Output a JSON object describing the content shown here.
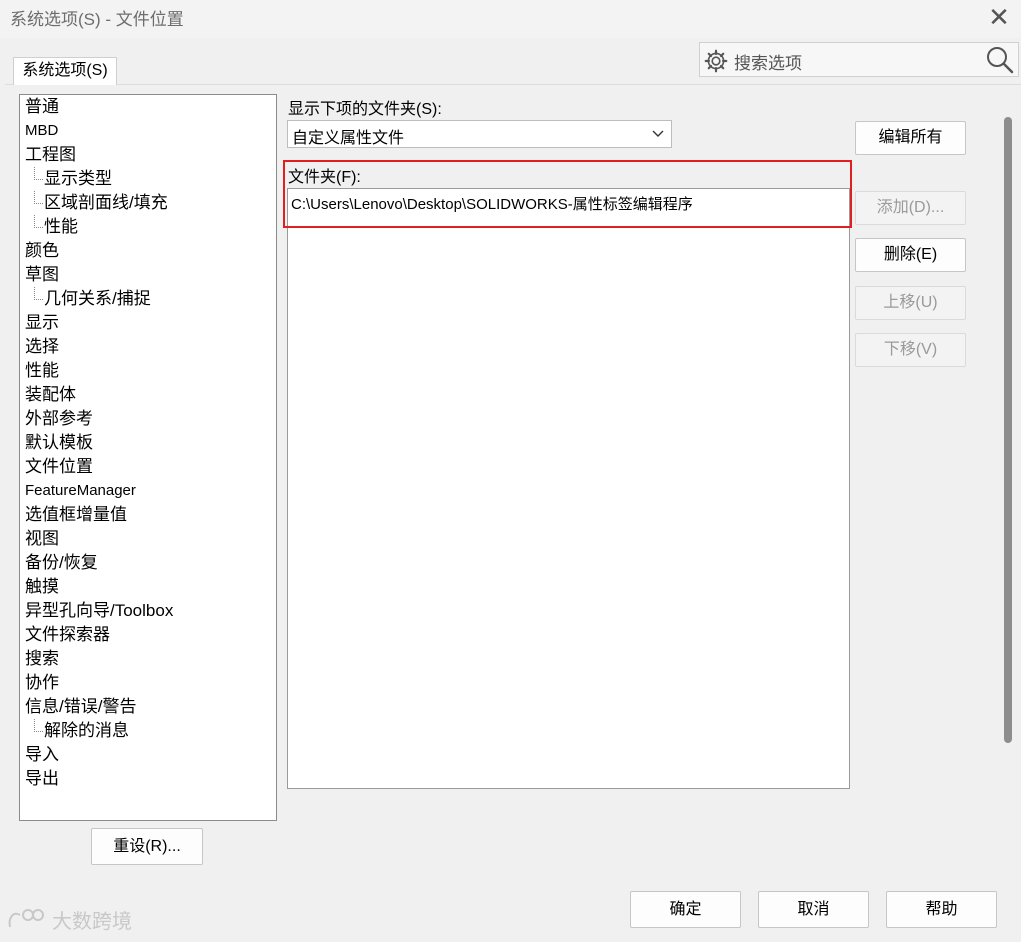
{
  "window": {
    "title": "系统选项(S) - 文件位置"
  },
  "search": {
    "placeholder": "搜索选项"
  },
  "tab": {
    "label": "系统选项(S)"
  },
  "tree": {
    "items": [
      {
        "label": "普通",
        "level": 0
      },
      {
        "label": "MBD",
        "level": 0
      },
      {
        "label": "工程图",
        "level": 0
      },
      {
        "label": "显示类型",
        "level": 1
      },
      {
        "label": "区域剖面线/填充",
        "level": 1
      },
      {
        "label": "性能",
        "level": 1
      },
      {
        "label": "颜色",
        "level": 0
      },
      {
        "label": "草图",
        "level": 0
      },
      {
        "label": "几何关系/捕捉",
        "level": 1
      },
      {
        "label": "显示",
        "level": 0
      },
      {
        "label": "选择",
        "level": 0
      },
      {
        "label": "性能",
        "level": 0
      },
      {
        "label": "装配体",
        "level": 0
      },
      {
        "label": "外部参考",
        "level": 0
      },
      {
        "label": "默认模板",
        "level": 0
      },
      {
        "label": "文件位置",
        "level": 0
      },
      {
        "label": "FeatureManager",
        "level": 0
      },
      {
        "label": "选值框增量值",
        "level": 0
      },
      {
        "label": "视图",
        "level": 0
      },
      {
        "label": "备份/恢复",
        "level": 0
      },
      {
        "label": "触摸",
        "level": 0
      },
      {
        "label": "异型孔向导/Toolbox",
        "level": 0
      },
      {
        "label": "文件探索器",
        "level": 0
      },
      {
        "label": "搜索",
        "level": 0
      },
      {
        "label": "协作",
        "level": 0
      },
      {
        "label": "信息/错误/警告",
        "level": 0
      },
      {
        "label": "解除的消息",
        "level": 1
      },
      {
        "label": "导入",
        "level": 0
      },
      {
        "label": "导出",
        "level": 0
      }
    ],
    "reset_label": "重设(R)..."
  },
  "main": {
    "show_folders_label": "显示下项的文件夹(S):",
    "folder_type_selected": "自定义属性文件",
    "folders_label": "文件夹(F):",
    "folders": [
      "C:\\Users\\Lenovo\\Desktop\\SOLIDWORKS-属性标签编辑程序"
    ]
  },
  "side_buttons": {
    "edit_all": "编辑所有",
    "add": "添加(D)...",
    "delete": "删除(E)",
    "move_up": "上移(U)",
    "move_down": "下移(V)"
  },
  "footer": {
    "ok": "确定",
    "cancel": "取消",
    "help": "帮助",
    "watermark": "大数跨境"
  },
  "colors": {
    "highlight": "#e02020",
    "background": "#f0f0f0"
  }
}
